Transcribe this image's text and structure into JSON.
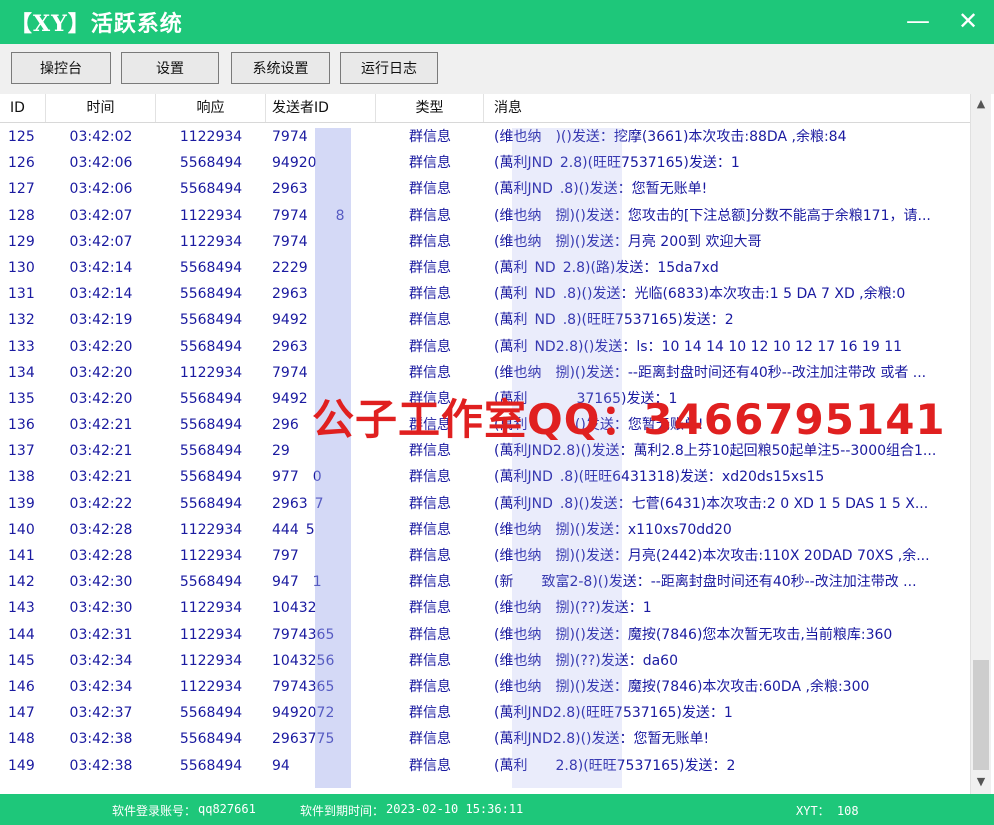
{
  "window": {
    "title": "【XY】活跃系统",
    "minimize": "—",
    "close": "✕"
  },
  "toolbar": {
    "buttons": [
      "操控台",
      "设置",
      "系统设置",
      "运行日志"
    ]
  },
  "table": {
    "columns": [
      "ID",
      "时间",
      "响应",
      "发送者ID",
      "类型",
      "消息"
    ],
    "rows": [
      [
        "125",
        "03:42:02",
        "1122934",
        "7974    ",
        "群信息",
        "(维也纳  )()发送：挖摩(3661)本次攻击:88DA ,余粮:84"
      ],
      [
        "126",
        "03:42:06",
        "5568494",
        "94920   ",
        "群信息",
        "(萬利JND 2.8)(旺旺7537165)发送：1"
      ],
      [
        "127",
        "03:42:06",
        "5568494",
        "2963    ",
        "群信息",
        "(萬利JND .8)()发送：您暂无账单!"
      ],
      [
        "128",
        "03:42:07",
        "1122934",
        "7974    8",
        "群信息",
        "(维也纳  捌)()发送：您攻击的[下注总额]分数不能高于余粮171，请..."
      ],
      [
        "129",
        "03:42:07",
        "1122934",
        "7974    ",
        "群信息",
        "(维也纳  捌)()发送：月亮 200到 欢迎大哥"
      ],
      [
        "130",
        "03:42:14",
        "5568494",
        "2229    ",
        "群信息",
        "(萬利 ND 2.8)(路)发送：15da7xd"
      ],
      [
        "131",
        "03:42:14",
        "5568494",
        "2963    ",
        "群信息",
        "(萬利 ND .8)()发送：光临(6833)本次攻击:1 5 DA 7 XD ,余粮:0"
      ],
      [
        "132",
        "03:42:19",
        "5568494",
        "9492    ",
        "群信息",
        "(萬利 ND .8)(旺旺7537165)发送：2"
      ],
      [
        "133",
        "03:42:20",
        "5568494",
        "2963    ",
        "群信息",
        "(萬利 ND2.8)()发送：ls：10 14 14 10 12 10 12 17 16 19 11"
      ],
      [
        "134",
        "03:42:20",
        "1122934",
        "7974    ",
        "群信息",
        "(维也纳  捌)()发送：--距离封盘时间还有40秒--改注加注带改 或者 ..."
      ],
      [
        "135",
        "03:42:20",
        "5568494",
        "9492    ",
        "群信息",
        "(萬利       37165)发送：1"
      ],
      [
        "136",
        "03:42:21",
        "5568494",
        "296     ",
        "群信息",
        "(萬利      )()发送：您暂无账单!"
      ],
      [
        "137",
        "03:42:21",
        "5568494",
        "29     ",
        "群信息",
        "(萬利JND2.8)()发送：萬利2.8上芬10起回粮50起单注5--3000组合1..."
      ],
      [
        "138",
        "03:42:21",
        "5568494",
        "977  0 ",
        "群信息",
        "(萬利JND .8)(旺旺6431318)发送：xd20ds15xs15"
      ],
      [
        "139",
        "03:42:22",
        "5568494",
        "2963 7 ",
        "群信息",
        "(萬利JND .8)()发送：七菅(6431)本次攻击:2 0 XD 1 5 DAS 1 5 X..."
      ],
      [
        "140",
        "03:42:28",
        "1122934",
        "444 5  ",
        "群信息",
        "(维也纳  捌)()发送：x110xs70dd20"
      ],
      [
        "141",
        "03:42:28",
        "1122934",
        "797    ",
        "群信息",
        "(维也纳  捌)()发送：月亮(2442)本次攻击:110X 20DAD 70XS ,余..."
      ],
      [
        "142",
        "03:42:30",
        "5568494",
        "947  1 ",
        "群信息",
        "(新    致富2-8)()发送：--距离封盘时间还有40秒--改注加注带改 ..."
      ],
      [
        "143",
        "03:42:30",
        "1122934",
        "10432   ",
        "群信息",
        "(维也纳  捌)(??)发送：1"
      ],
      [
        "144",
        "03:42:31",
        "1122934",
        "7974365 ",
        "群信息",
        "(维也纳  捌)()发送：魔按(7846)您本次暂无攻击,当前粮库:360"
      ],
      [
        "145",
        "03:42:34",
        "1122934",
        "1043256 ",
        "群信息",
        "(维也纳  捌)(??)发送：da60"
      ],
      [
        "146",
        "03:42:34",
        "1122934",
        "7974365 ",
        "群信息",
        "(维也纳  捌)()发送：魔按(7846)本次攻击:60DA ,余粮:300"
      ],
      [
        "147",
        "03:42:37",
        "5568494",
        "9492072 ",
        "群信息",
        "(萬利JND2.8)(旺旺7537165)发送：1"
      ],
      [
        "148",
        "03:42:38",
        "5568494",
        "2963775 ",
        "群信息",
        "(萬利JND2.8)()发送：您暂无账单!"
      ],
      [
        "149",
        "03:42:38",
        "5568494",
        "94     ",
        "群信息",
        "(萬利    2.8)(旺旺7537165)发送：2"
      ]
    ]
  },
  "scrollbar": {
    "up": "▲",
    "down": "▼"
  },
  "watermark": "公子工作室QQ：3466795141",
  "status": {
    "account_label": "软件登录账号：",
    "account_value": "qq827661",
    "expire_label": "软件到期时间：",
    "expire_value": "2023-02-10 15:36:11",
    "xyt": "XYT：  108"
  },
  "colors": {
    "accent": "#1ec77a",
    "row_text": "#1a1aa0",
    "watermark": "#e02020"
  }
}
